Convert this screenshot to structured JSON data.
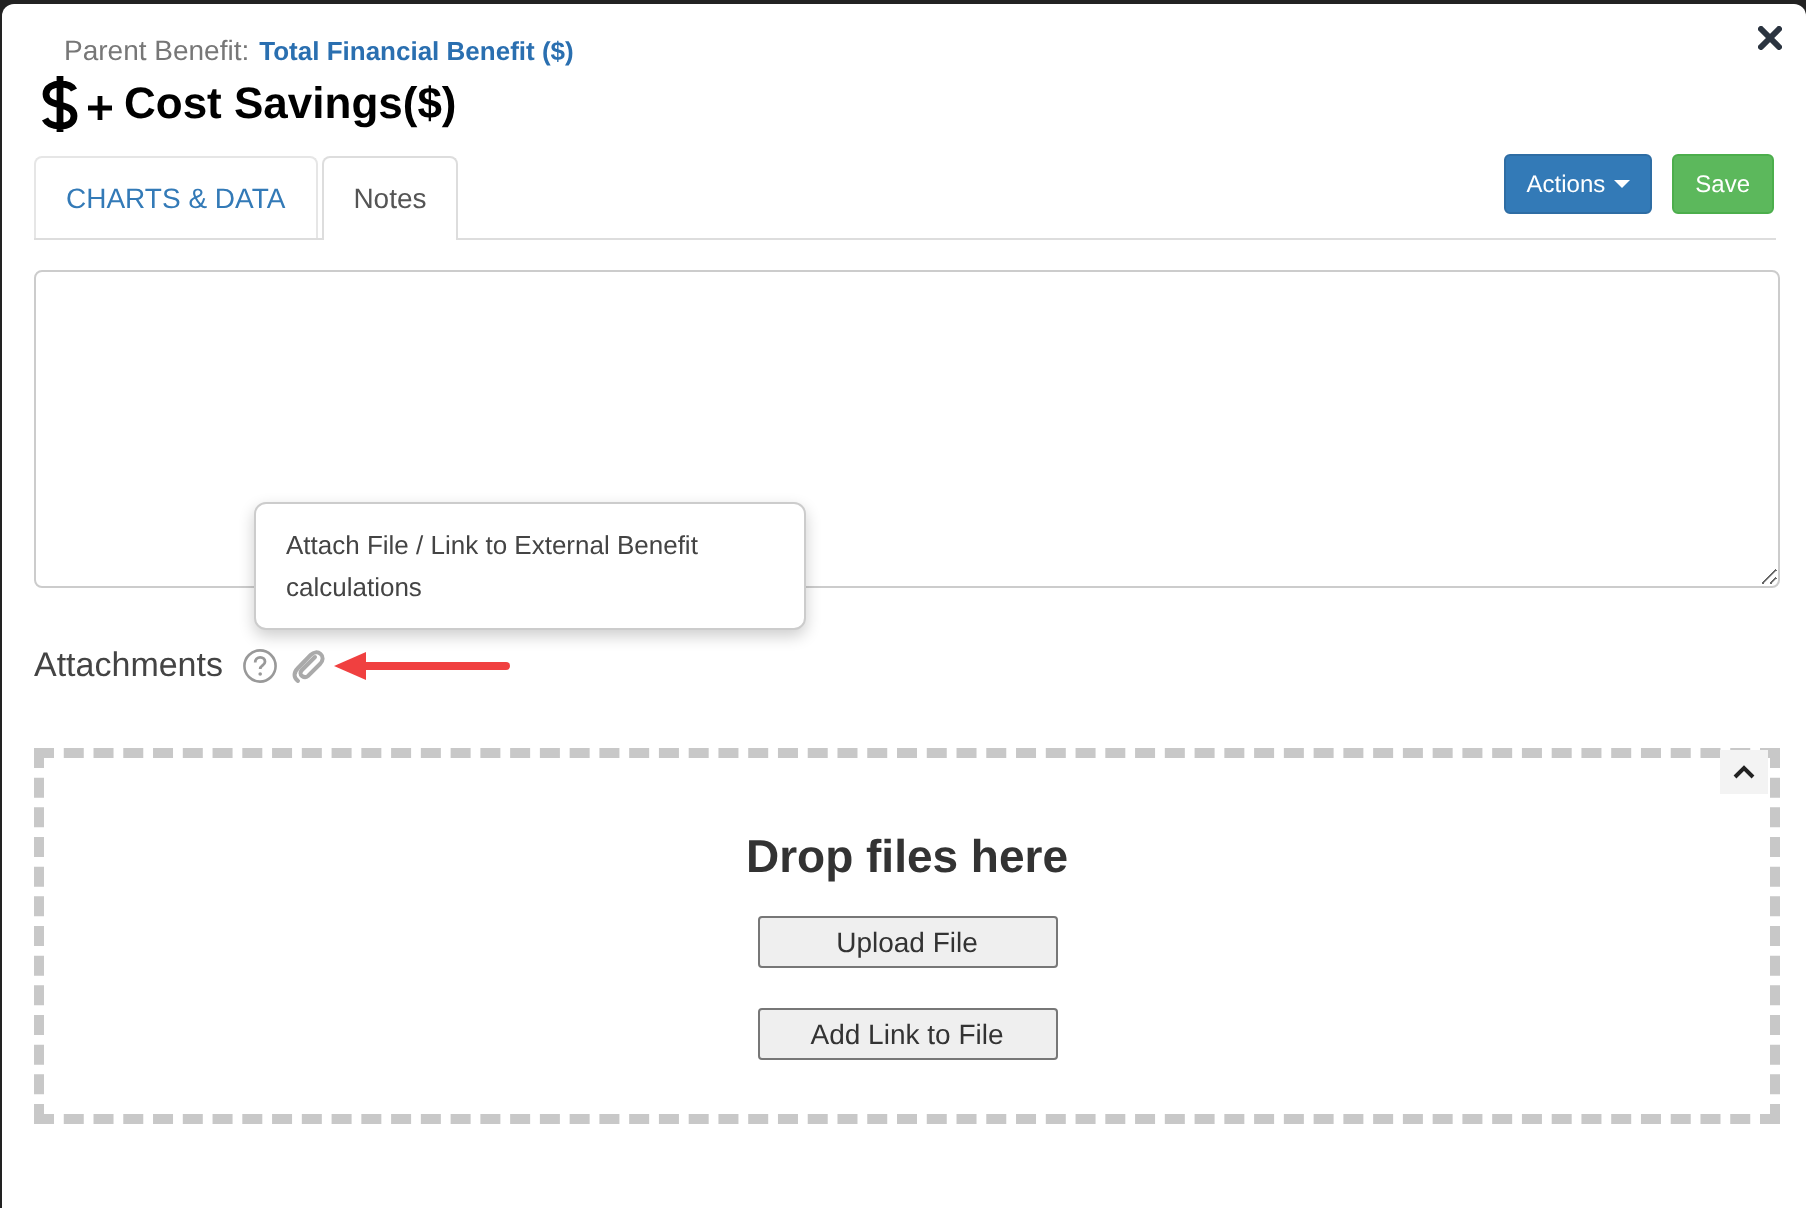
{
  "header": {
    "parent_label": "Parent Benefit:",
    "parent_link": "Total Financial Benefit ($)",
    "title": "Cost Savings($)"
  },
  "tabs": [
    {
      "label": "CHARTS & DATA",
      "selected": false
    },
    {
      "label": "Notes",
      "selected": true
    }
  ],
  "actions": {
    "menu": "Actions",
    "save": "Save"
  },
  "attachments": {
    "label": "Attachments",
    "tooltip": "Attach File / Link to External Benefit calculations"
  },
  "dropzone": {
    "heading": "Drop files here",
    "buttons": [
      "Upload File",
      "Add Link to File"
    ]
  }
}
